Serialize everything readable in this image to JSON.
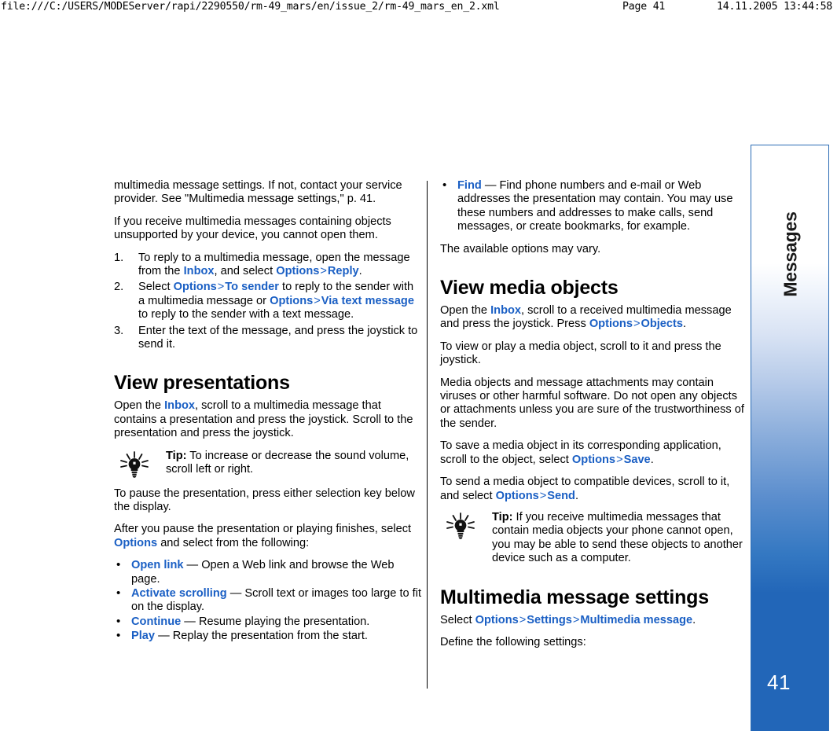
{
  "print_header": {
    "url": "file:///C:/USERS/MODEServer/rapi/2290550/rm-49_mars/en/issue_2/rm-49_mars_en_2.xml",
    "page": "Page 41",
    "date": "14.11.2005 13:44:58"
  },
  "side_tab": {
    "label": "Messages",
    "page_number": "41",
    "accent_color": "#2266b8",
    "border_color": "#2b6cb5"
  },
  "link_color": "#1a5fc4",
  "left_column": {
    "p1_part1": "multimedia message settings. If not, contact your service provider. See \"Multimedia message settings,\" p. 41.",
    "p2": "If you receive multimedia messages containing objects unsupported by your device, you cannot open them.",
    "steps": [
      {
        "num": "1.",
        "t1": "To reply to a multimedia message, open the message from the ",
        "l1": "Inbox",
        "t2": ", and select ",
        "l2": "Options",
        "gt1": ">",
        "l3": "Reply",
        "t3": "."
      },
      {
        "num": "2.",
        "t1": "Select ",
        "l1": "Options",
        "gt1": ">",
        "l2": "To sender",
        "t2": " to reply to the sender with a multimedia message or ",
        "l3": "Options",
        "gt2": ">",
        "l4": "Via text message",
        "t3": " to reply to the sender with a text message."
      },
      {
        "num": "3.",
        "t1": "Enter the text of the message, and press the joystick to send it."
      }
    ],
    "heading_view_presentations": "View presentations",
    "p3_t1": "Open the ",
    "p3_l1": "Inbox",
    "p3_t2": ", scroll to a multimedia message that contains a presentation and press the joystick. Scroll to the presentation and press the joystick.",
    "tip": {
      "label": "Tip:",
      "text": " To increase or decrease the sound volume, scroll left or right."
    },
    "p4": "To pause the presentation, press either selection key below the display.",
    "p5_t1": "After you pause the presentation or playing finishes, select ",
    "p5_l1": "Options",
    "p5_t2": " and select from the following:",
    "bullets": [
      {
        "link": "Open link",
        "dash": " — ",
        "text": "Open a Web link and browse the Web page."
      },
      {
        "link": "Activate scrolling",
        "dash": " — ",
        "text": "Scroll text or images too large to fit on the display."
      },
      {
        "link": "Continue",
        "dash": " — ",
        "text": "Resume playing the presentation."
      },
      {
        "link": "Play",
        "dash": " — ",
        "text": "Replay the presentation from the start."
      }
    ]
  },
  "right_column": {
    "bullet_find": {
      "link": "Find",
      "dash": " — ",
      "text": "Find phone numbers and e-mail or Web addresses the presentation may contain. You may use these numbers and addresses to make calls, send messages, or create bookmarks, for example."
    },
    "p1": "The available options may vary.",
    "heading_view_media_objects": "View media objects",
    "p2_t1": "Open the ",
    "p2_l1": "Inbox",
    "p2_t2": ", scroll to a received multimedia message and press the joystick. Press ",
    "p2_l2": "Options",
    "p2_gt": ">",
    "p2_l3": "Objects",
    "p2_t3": ".",
    "p3": "To view or play a media object, scroll to it and press the joystick.",
    "p4": "Media objects and message attachments may contain viruses or other harmful software. Do not open any objects or attachments unless you are sure of the trustworthiness of the sender.",
    "p5_t1": "To save a media object in its corresponding application, scroll to the object, select ",
    "p5_l1": "Options",
    "p5_gt": ">",
    "p5_l2": "Save",
    "p5_t2": ".",
    "p6_t1": "To send a media object to compatible devices, scroll to it, and select ",
    "p6_l1": "Options",
    "p6_gt": ">",
    "p6_l2": "Send",
    "p6_t2": ".",
    "tip": {
      "label": "Tip:",
      "text": " If you receive multimedia messages that contain media objects your phone cannot open, you may be able to send these objects to another device such as a computer."
    },
    "heading_mms_settings": "Multimedia message settings",
    "p7_t1": "Select ",
    "p7_l1": "Options",
    "p7_gt1": ">",
    "p7_l2": "Settings",
    "p7_gt2": ">",
    "p7_l3": "Multimedia message",
    "p7_t2": ".",
    "p8": "Define the following settings:"
  }
}
